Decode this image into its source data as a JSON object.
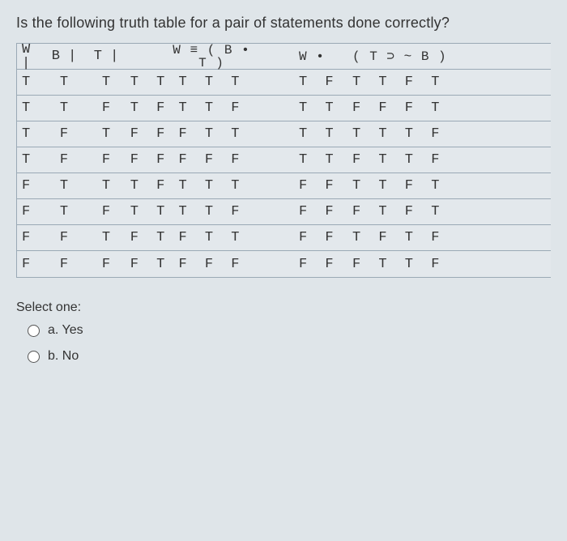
{
  "question": "Is the following truth table for a pair of statements done correctly?",
  "table": {
    "headers": {
      "c1": "W",
      "c2": "B",
      "c3": "T",
      "c4": "|",
      "c5": "W ≡ ( B • T )",
      "c6": "W •",
      "c7": "( T ⊃ ~ B )"
    },
    "rows": [
      {
        "c1": "T",
        "c2": "T",
        "c3": "T",
        "c4": "T T",
        "c5": "T T T",
        "c6": "T F",
        "c7": "T T F T"
      },
      {
        "c1": "T",
        "c2": "T",
        "c3": "F",
        "c4": "T F",
        "c5": "T T F",
        "c6": "T T",
        "c7": "F F F T"
      },
      {
        "c1": "T",
        "c2": "F",
        "c3": "T",
        "c4": "F F",
        "c5": "F T T",
        "c6": "T T",
        "c7": "T T T F"
      },
      {
        "c1": "T",
        "c2": "F",
        "c3": "F",
        "c4": "F F",
        "c5": "F F F",
        "c6": "T T",
        "c7": "F T T F"
      },
      {
        "c1": "F",
        "c2": "T",
        "c3": "T",
        "c4": "T F",
        "c5": "T T T",
        "c6": "F F",
        "c7": "T T F T"
      },
      {
        "c1": "F",
        "c2": "T",
        "c3": "F",
        "c4": "T T",
        "c5": "T T F",
        "c6": "F F",
        "c7": "F T F T"
      },
      {
        "c1": "F",
        "c2": "F",
        "c3": "T",
        "c4": "F T",
        "c5": "F T T",
        "c6": "F F",
        "c7": "T F T F"
      },
      {
        "c1": "F",
        "c2": "F",
        "c3": "F",
        "c4": "F T",
        "c5": "F F F",
        "c6": "F F",
        "c7": "F T T F"
      }
    ]
  },
  "select_label": "Select one:",
  "options": {
    "a": "a. Yes",
    "b": "b. No"
  }
}
